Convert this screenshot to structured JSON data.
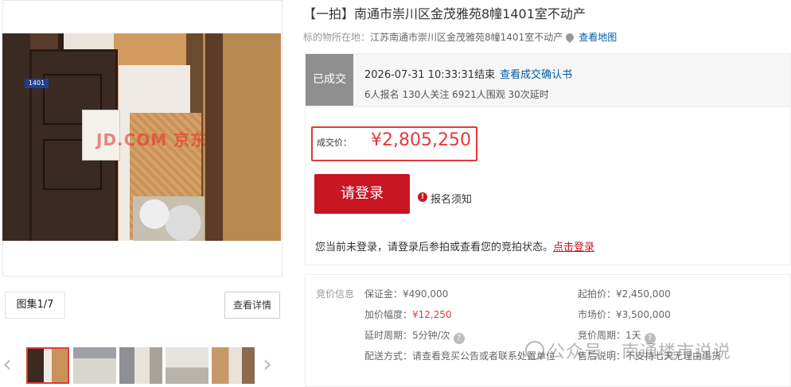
{
  "listing": {
    "title": "【一拍】南通市崇川区金茂雅苑8幢1401室不动产",
    "location_label": "标的物所在地：",
    "location_value": "江苏南通市崇川区金茂雅苑8幢1401室不动产",
    "map_link": "查看地图"
  },
  "gallery": {
    "counter": "图集1/7",
    "detail_button": "查看详情",
    "door_number": "1401",
    "watermark": "JD.COM 京东"
  },
  "status": {
    "tag": "已成交",
    "end_time": "2026-07-31 10:33:31结束",
    "confirm_link": "查看成交确认书",
    "stats": "6人报名  130人关注  6921人围观  30次延时"
  },
  "price": {
    "label": "成交价：",
    "value": "¥2,805,250"
  },
  "actions": {
    "login_button": "请登录",
    "notice_icon": "!",
    "notice_link": "报名须知",
    "login_hint": "您当前未登录，请登录后参拍或查看您的竞拍状态。",
    "login_hint_link": "点击登录"
  },
  "bid_info": {
    "section_title": "竞价信息",
    "deposit": "保证金：¥490,000",
    "increment_label": "加价幅度：",
    "increment_value": "¥12,250",
    "extension": "延时周期：5分钟/次",
    "delivery": "配送方式：请查看竞买公告或者联系处置单位",
    "start_price": "起拍价：¥2,450,000",
    "market_price": "市场价：¥3,500,000",
    "bid_cycle": "竞价周期：1天",
    "after_sales": "售后说明：不支持七天无理由退货"
  },
  "overlay_watermark": "公众号 · 南通楼市说说",
  "icons": {
    "arrow_left": "‹",
    "arrow_right": "›",
    "question": "?"
  }
}
